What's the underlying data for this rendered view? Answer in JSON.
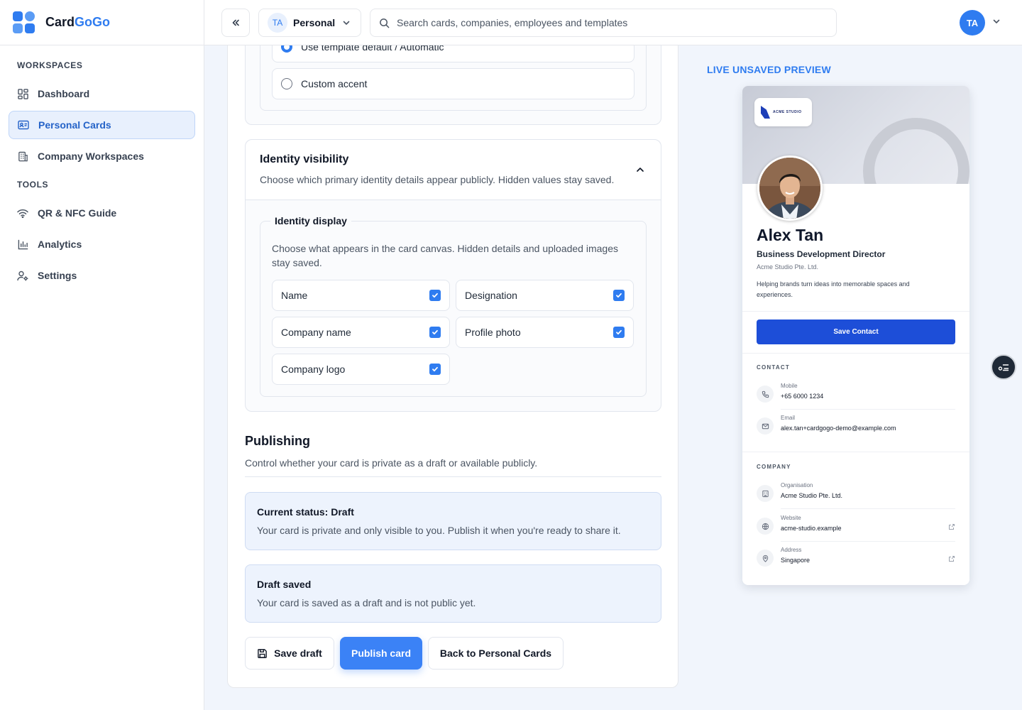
{
  "brand": {
    "name_part1": "Card",
    "name_part2": "GoGo"
  },
  "sidebar": {
    "section_workspaces": "WORKSPACES",
    "section_tools": "TOOLS",
    "items": [
      {
        "label": "Dashboard",
        "icon": "dashboard-icon"
      },
      {
        "label": "Personal Cards",
        "icon": "id-card-icon",
        "active": true
      },
      {
        "label": "Company Workspaces",
        "icon": "building-icon"
      },
      {
        "label": "QR & NFC Guide",
        "icon": "wifi-icon"
      },
      {
        "label": "Analytics",
        "icon": "bar-chart-icon"
      },
      {
        "label": "Settings",
        "icon": "user-settings-icon"
      }
    ]
  },
  "topbar": {
    "workspace_badge": "TA",
    "workspace_label": "Personal",
    "search_placeholder": "Search cards, companies, employees and templates",
    "avatar": "TA"
  },
  "accent": {
    "option_auto": "Use template default / Automatic",
    "option_custom": "Custom accent"
  },
  "identity": {
    "title": "Identity visibility",
    "description": "Choose which primary identity details appear publicly. Hidden values stay saved.",
    "legend": "Identity display",
    "help": "Choose what appears in the card canvas. Hidden details and uploaded images stay saved.",
    "options": [
      {
        "label": "Name",
        "checked": true
      },
      {
        "label": "Designation",
        "checked": true
      },
      {
        "label": "Company name",
        "checked": true
      },
      {
        "label": "Profile photo",
        "checked": true
      },
      {
        "label": "Company logo",
        "checked": true
      }
    ]
  },
  "publishing": {
    "title": "Publishing",
    "description": "Control whether your card is private as a draft or available publicly.",
    "status_title": "Current status: Draft",
    "status_text": "Your card is private and only visible to you. Publish it when you're ready to share it.",
    "saved_title": "Draft saved",
    "saved_text": "Your card is saved as a draft and is not public yet."
  },
  "actions": {
    "save_draft": "Save draft",
    "publish": "Publish card",
    "back": "Back to Personal Cards"
  },
  "preview": {
    "label": "LIVE UNSAVED PREVIEW",
    "logo_text": "ACME STUDIO",
    "name": "Alex Tan",
    "role": "Business Development Director",
    "company": "Acme Studio Pte. Ltd.",
    "bio": "Helping brands turn ideas into memorable spaces and experiences.",
    "save_contact": "Save Contact",
    "contact_section": "CONTACT",
    "contact": [
      {
        "label": "Mobile",
        "value": "+65 6000 1234",
        "icon": "phone-icon"
      },
      {
        "label": "Email",
        "value": "alex.tan+cardgogo-demo@example.com",
        "icon": "mail-icon"
      }
    ],
    "company_section": "COMPANY",
    "company_rows": [
      {
        "label": "Organisation",
        "value": "Acme Studio Pte. Ltd.",
        "icon": "building-icon"
      },
      {
        "label": "Website",
        "value": "acme-studio.example",
        "icon": "globe-icon"
      },
      {
        "label": "Address",
        "value": "Singapore",
        "icon": "map-pin-icon"
      }
    ]
  },
  "colors": {
    "primary": "#3b82f6",
    "brand_dark": "#1d4ed8",
    "active_bg": "#e8f0fd"
  }
}
